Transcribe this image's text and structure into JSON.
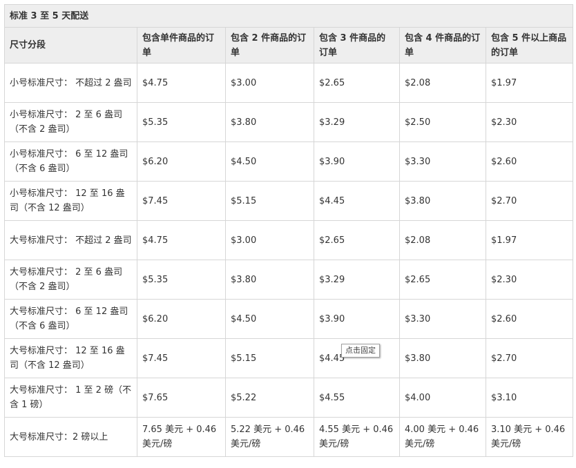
{
  "table": {
    "title": "标准 3 至 5 天配送",
    "headers": [
      "尺寸分段",
      "包含单件商品的订单",
      "包含 2 件商品的订单",
      "包含 3 件商品的订单",
      "包含 4 件商品的订单",
      "包含 5 件以上商品的订单"
    ],
    "rows": [
      [
        "小号标准尺寸： 不超过 2 盎司",
        "$4.75",
        "$3.00",
        "$2.65",
        "$2.08",
        "$1.97"
      ],
      [
        "小号标准尺寸： 2 至 6 盎司（不含 2 盎司）",
        "$5.35",
        "$3.80",
        "$3.29",
        "$2.50",
        "$2.30"
      ],
      [
        "小号标准尺寸： 6 至 12 盎司（不含 6 盎司）",
        "$6.20",
        "$4.50",
        "$3.90",
        "$3.30",
        "$2.60"
      ],
      [
        "小号标准尺寸： 12 至 16 盎司（不含 12 盎司）",
        "$7.45",
        "$5.15",
        "$4.45",
        "$3.80",
        "$2.70"
      ],
      [
        "大号标准尺寸： 不超过 2 盎司",
        "$4.75",
        "$3.00",
        "$2.65",
        "$2.08",
        "$1.97"
      ],
      [
        "大号标准尺寸： 2 至 6 盎司（不含 2 盎司）",
        "$5.35",
        "$3.80",
        "$3.29",
        "$2.65",
        "$2.30"
      ],
      [
        "大号标准尺寸： 6 至 12 盎司（不含 6 盎司）",
        "$6.20",
        "$4.50",
        "$3.90",
        "$3.30",
        "$2.60"
      ],
      [
        "大号标准尺寸： 12 至 16 盎司（不含 12 盎司）",
        "$7.45",
        "$5.15",
        "$4.45",
        "$3.80",
        "$2.70"
      ],
      [
        "大号标准尺寸： 1 至 2 磅（不含 1 磅）",
        "$7.65",
        "$5.22",
        "$4.55",
        "$4.00",
        "$3.10"
      ],
      [
        "大号标准尺寸：2 磅以上",
        "7.65 美元 + 0.46 美元/磅",
        "5.22 美元 + 0.46 美元/磅",
        "4.55 美元 + 0.46 美元/磅",
        "4.00 美元 + 0.46 美元/磅",
        "3.10 美元 + 0.46 美元/磅"
      ]
    ]
  },
  "tooltip": {
    "text": "点击固定"
  }
}
